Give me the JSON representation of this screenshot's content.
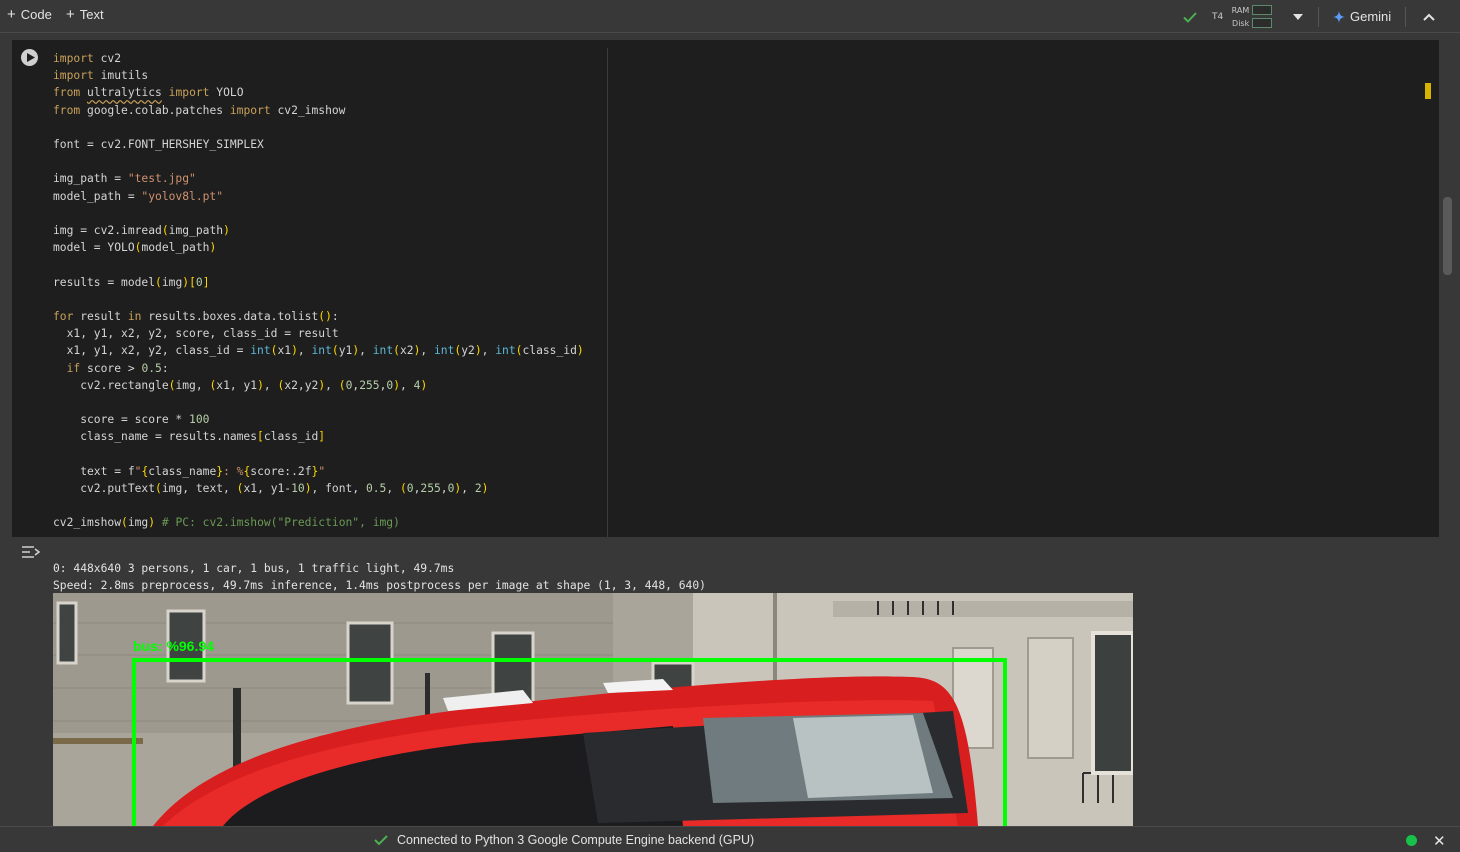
{
  "toolbar": {
    "add_code_label": "Code",
    "add_text_label": "Text",
    "gpu": "T4",
    "ram_label": "RAM",
    "disk_label": "Disk",
    "gemini_label": "Gemini"
  },
  "output": {
    "line1": "0: 448x640 3 persons, 1 car, 1 bus, 1 traffic light, 49.7ms",
    "line2": "Speed: 2.8ms preprocess, 49.7ms inference, 1.4ms postprocess per image at shape (1, 3, 448, 640)",
    "detection_label": "bus: %96.94"
  },
  "status": {
    "text": "Connected to Python 3 Google Compute Engine backend (GPU)"
  },
  "colors": {
    "background": "#383838",
    "cell_bg": "#1e1e1e",
    "detection_box": "#00ff00",
    "status_dot": "#17c24a"
  }
}
